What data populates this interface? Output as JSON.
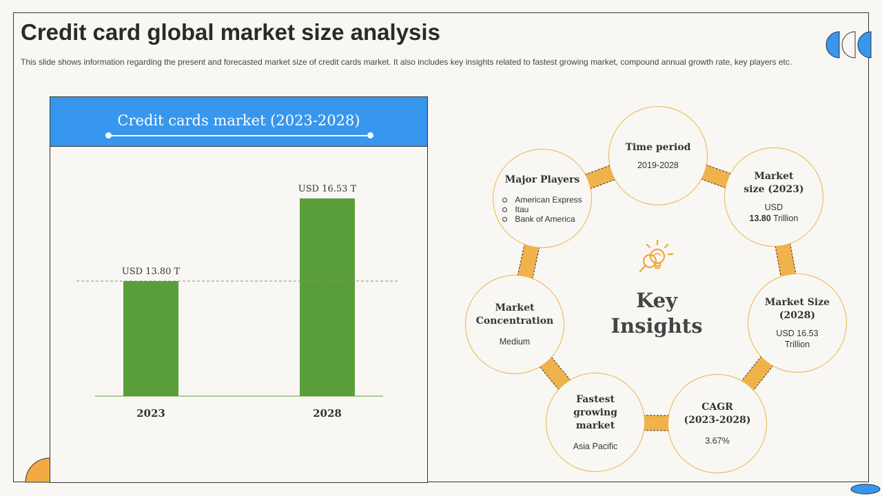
{
  "title": "Credit card global market size analysis",
  "subtitle": "This slide shows information regarding the present and forecasted market size of credit cards market. It also includes key insights related to fastest growing market, compound annual growth rate, key players etc.",
  "colors": {
    "bar": "#5a9e3b",
    "header": "#3797ee",
    "accent": "#f0b24a",
    "text": "#333333"
  },
  "chart_data": {
    "type": "bar",
    "title": "Credit cards market (2023-2028)",
    "categories": [
      "2023",
      "2028"
    ],
    "values": [
      13.8,
      16.53
    ],
    "value_labels": [
      "USD 13.80 T",
      "USD 16.53 T"
    ],
    "unit": "USD Trillion",
    "reference_line_value": 13.8
  },
  "insights": {
    "center_title_line1": "Key",
    "center_title_line2": "Insights",
    "icon": "lightbulb-search-icon",
    "time_period": {
      "title": "Time period",
      "value": "2019-2028"
    },
    "market_size_2023": {
      "title_line1": "Market",
      "title_line2": "size (2023)",
      "value_line1": "USD",
      "value_number": "13.80",
      "value_unit": "Trillion"
    },
    "market_size_2028": {
      "title_line1": "Market Size",
      "title_line2": "(2028)",
      "value_line1": "USD  16.53",
      "value_line2": "Trillion"
    },
    "cagr": {
      "title_line1": "CAGR",
      "title_line2": "(2023-2028)",
      "value": "3.67%"
    },
    "fastest_growing": {
      "title_line1": "Fastest",
      "title_line2": "growing market",
      "value": "Asia Pacific"
    },
    "market_concentration": {
      "title_line1": "Market",
      "title_line2": "Concentration",
      "value": "Medium"
    },
    "major_players": {
      "title": "Major Players",
      "items": [
        "American Express",
        "Itau",
        "Bank of America"
      ]
    }
  }
}
